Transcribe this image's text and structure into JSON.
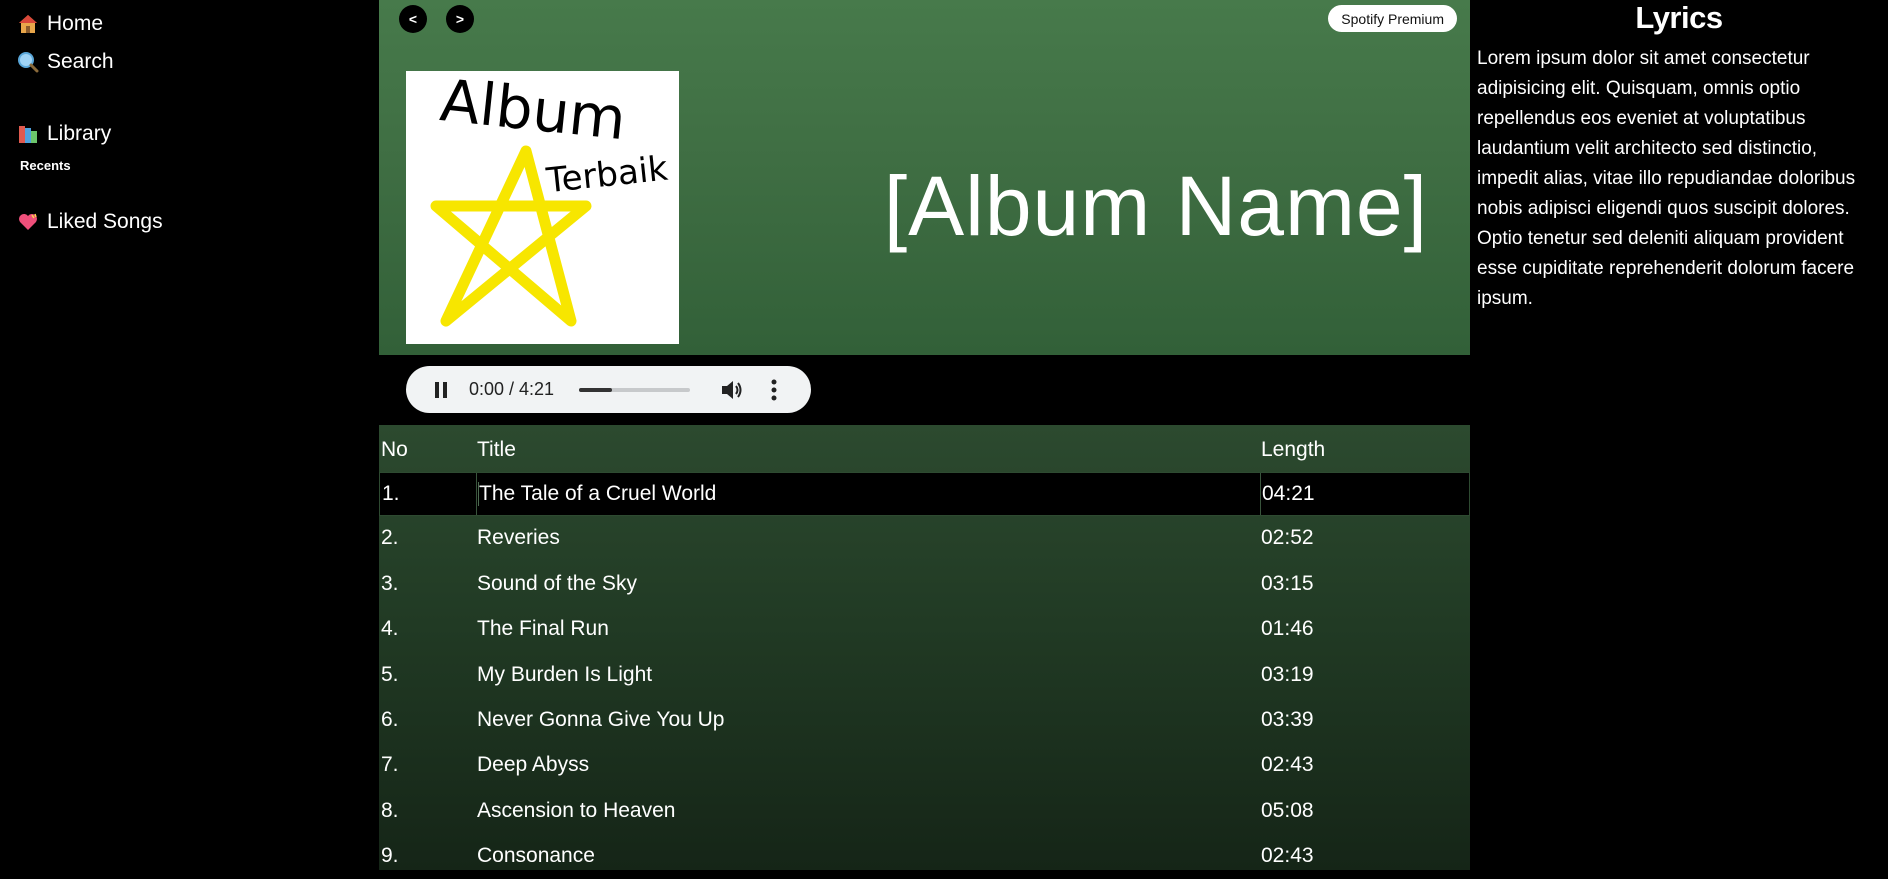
{
  "sidebar": {
    "items": [
      {
        "label": "Home",
        "icon": "house-icon"
      },
      {
        "label": "Search",
        "icon": "magnifier-icon"
      },
      {
        "label": "Library",
        "icon": "books-icon"
      },
      {
        "label": "Liked Songs",
        "icon": "heart-icon"
      }
    ],
    "recents_label": "Recents"
  },
  "header": {
    "back_label": "<",
    "forward_label": ">",
    "premium_label": "Spotify Premium"
  },
  "album": {
    "name": "[Album Name]",
    "cover_text_1": "Album",
    "cover_text_2": "Terbaik"
  },
  "player": {
    "time": "0:00 / 4:21",
    "progress": 0.3
  },
  "table": {
    "headers": {
      "no": "No",
      "title": "Title",
      "length": "Length"
    },
    "rows": [
      {
        "no": "1.",
        "title": "The Tale of a Cruel World",
        "length": "04:21",
        "selected": true
      },
      {
        "no": "2.",
        "title": "Reveries",
        "length": "02:52"
      },
      {
        "no": "3.",
        "title": "Sound of the Sky",
        "length": "03:15"
      },
      {
        "no": "4.",
        "title": "The Final Run",
        "length": "01:46"
      },
      {
        "no": "5.",
        "title": "My Burden Is Light",
        "length": "03:19"
      },
      {
        "no": "6.",
        "title": "Never Gonna Give You Up",
        "length": "03:39"
      },
      {
        "no": "7.",
        "title": "Deep Abyss",
        "length": "02:43"
      },
      {
        "no": "8.",
        "title": "Ascension to Heaven",
        "length": "05:08"
      },
      {
        "no": "9.",
        "title": "Consonance",
        "length": "02:43"
      }
    ]
  },
  "lyrics": {
    "title": "Lyrics",
    "text": "Lorem ipsum dolor sit amet consectetur adipisicing elit. Quisquam, omnis optio repellendus eos eveniet at voluptatibus laudantium velit architecto sed distinctio, impedit alias, vitae illo repudiandae doloribus nobis adipisci eligendi quos suscipit dolores. Optio tenetur sed deleniti aliquam provident esse cupiditate reprehenderit dolorum facere ipsum."
  },
  "colors": {
    "hero_green": "#477a4b",
    "table_green": "#2c4a2f",
    "star_yellow": "#f7e600"
  }
}
